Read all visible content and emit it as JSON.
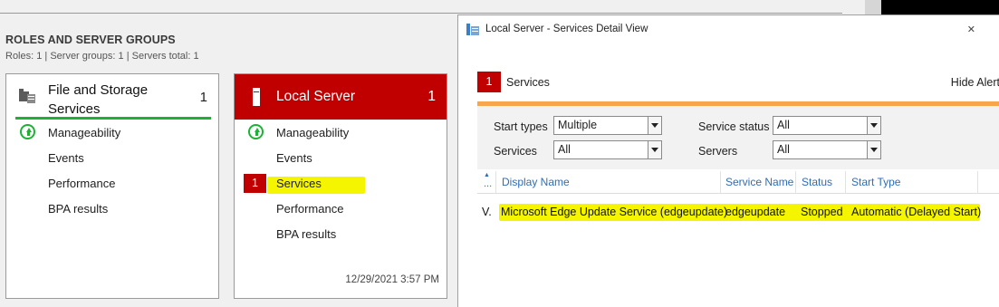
{
  "section": {
    "title": "ROLES AND SERVER GROUPS",
    "subtitle": "Roles: 1   |   Server groups: 1   |   Servers total: 1"
  },
  "tile_file_storage": {
    "title_line1": "File and Storage",
    "title_line2": "Services",
    "count": "1",
    "items": [
      "Manageability",
      "Events",
      "Performance",
      "BPA results"
    ]
  },
  "tile_local_server": {
    "title": "Local Server",
    "count": "1",
    "items": [
      "Manageability",
      "Events",
      "Services",
      "Performance",
      "BPA results"
    ],
    "services_badge": "1",
    "timestamp": "12/29/2021 3:57 PM"
  },
  "detail_window": {
    "title": "Local Server - Services Detail View",
    "close": "✕",
    "alert_count": "1",
    "alert_label": "Services",
    "hide_alert": "Hide Alert",
    "filters": {
      "start_types_label": "Start types",
      "start_types_value": "Multiple",
      "service_status_label": "Service status",
      "service_status_value": "All",
      "services_label": "Services",
      "services_value": "All",
      "servers_label": "Servers",
      "servers_value": "All"
    },
    "columns": [
      "Display Name",
      "Service Name",
      "Status",
      "Start Type"
    ],
    "sort_dots": "...",
    "rows": [
      {
        "prefix": "V.",
        "display_name": "Microsoft Edge Update Service (edgeupdate)",
        "service_name": "edgeupdate",
        "status": "Stopped",
        "start_type": "Automatic (Delayed Start)"
      }
    ]
  },
  "colors": {
    "alert_red": "#c00000",
    "ok_green": "#1fb136",
    "highlight_yellow": "#f5f500",
    "alert_orange": "#f7a64a",
    "link_blue": "#2f6db5"
  }
}
